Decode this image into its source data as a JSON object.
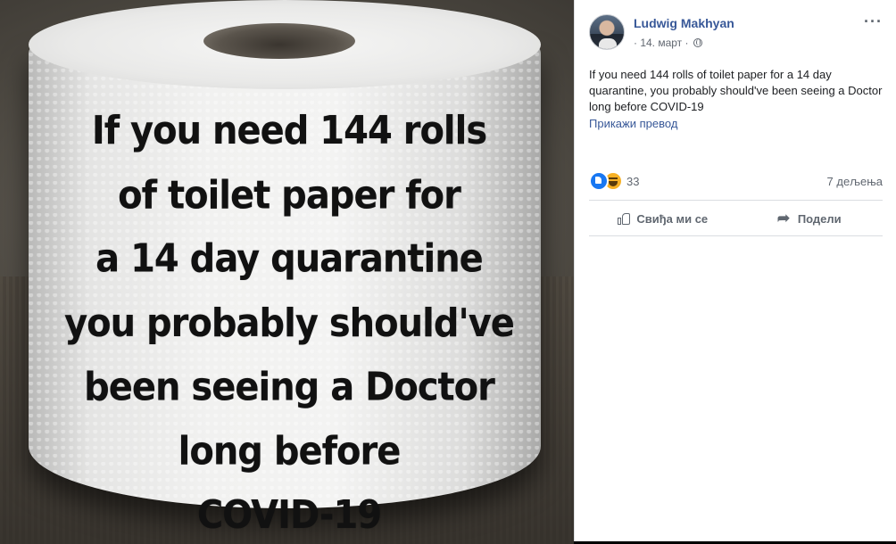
{
  "photo": {
    "lines": [
      "If you need 144 rolls",
      "of toilet paper for",
      "a 14 day quarantine",
      "you probably should've",
      "been seeing a Doctor",
      "long before",
      "COVID-19"
    ]
  },
  "post": {
    "author": "Ludwig Makhyan",
    "date": "· 14. март ·",
    "more_icon": "···",
    "text": "If you need 144 rolls of toilet paper for a 14 day quarantine, you probably should've been seeing a Doctor long before COVID-19",
    "translate_link": "Прикажи превод",
    "reaction_count": "33",
    "shares": "7 дељења",
    "like_label": "Свиђа ми се",
    "share_label": "Подели"
  },
  "colors": {
    "link": "#385898",
    "muted": "#606770",
    "like_blue": "#1877f2",
    "haha_yellow": "#f7b125"
  }
}
